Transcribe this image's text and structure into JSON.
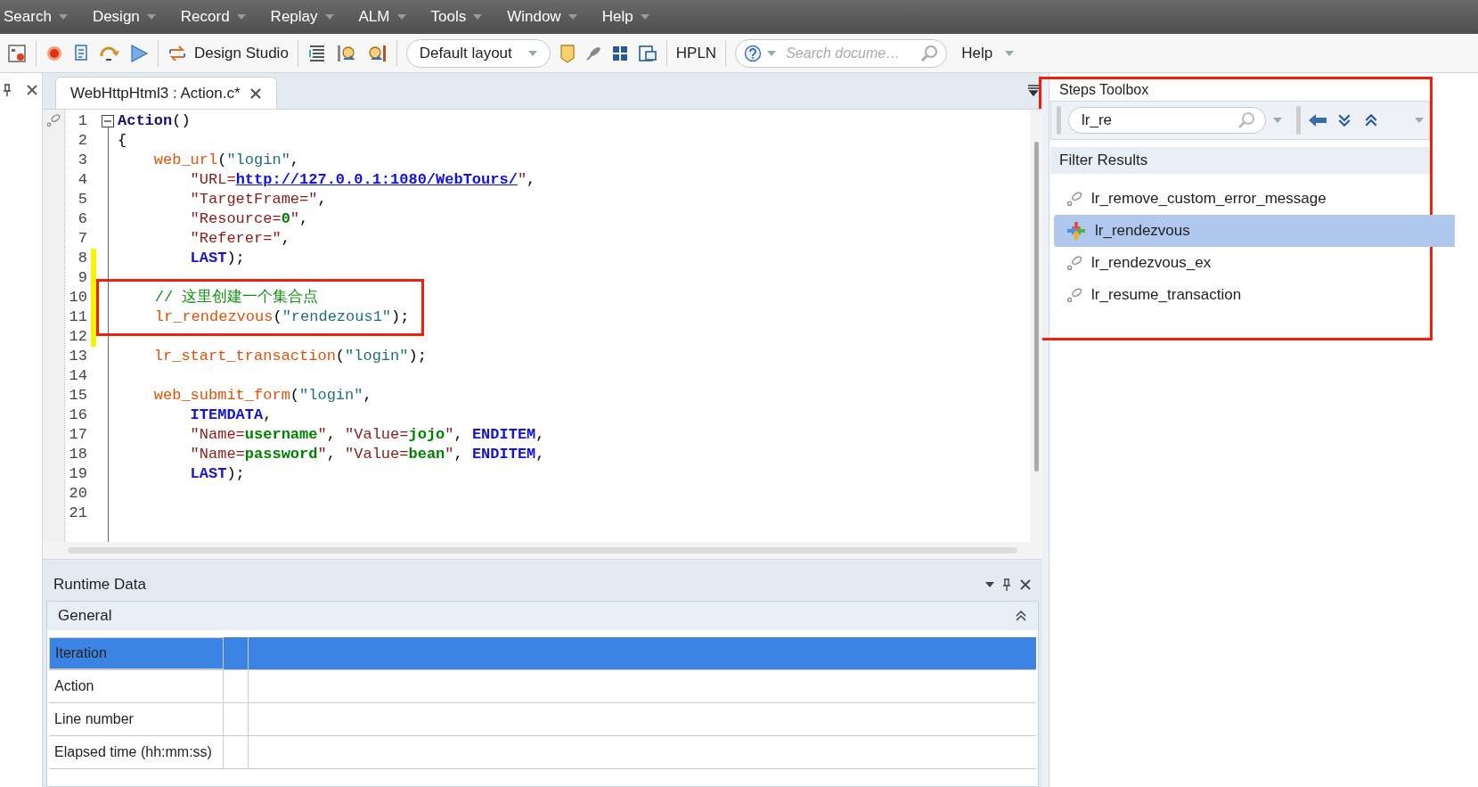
{
  "menu_bar": [
    "Search",
    "Design",
    "Record",
    "Replay",
    "ALM",
    "Tools",
    "Window",
    "Help"
  ],
  "toolbar": {
    "design_studio": "Design Studio",
    "layout": "Default layout",
    "hpln": "HPLN",
    "search_placeholder": "Search docume…",
    "help": "Help"
  },
  "editor": {
    "tab": {
      "label": "WebHttpHtml3 : Action.c*",
      "selected": true
    },
    "lines": [
      {
        "number": "1",
        "changed": false,
        "boxed": false,
        "tokens": [
          {
            "kind": "decl",
            "text": "Action"
          },
          {
            "kind": "punct",
            "text": "()"
          }
        ]
      },
      {
        "number": "2",
        "changed": false,
        "boxed": false,
        "tokens": [
          {
            "kind": "punct",
            "text": "{"
          }
        ]
      },
      {
        "number": "3",
        "changed": false,
        "boxed": false,
        "tokens": [
          {
            "kind": "fn",
            "text": "    web_url"
          },
          {
            "kind": "punct",
            "text": "("
          },
          {
            "kind": "str",
            "text": "\"login\""
          },
          {
            "kind": "punct",
            "text": ","
          }
        ]
      },
      {
        "number": "4",
        "changed": false,
        "boxed": false,
        "tokens": [
          {
            "kind": "attr",
            "text": "        \"URL="
          },
          {
            "kind": "link",
            "text": "http://127.0.0.1:1080/WebTours/"
          },
          {
            "kind": "attr",
            "text": "\""
          },
          {
            "kind": "punct",
            "text": ","
          }
        ]
      },
      {
        "number": "5",
        "changed": false,
        "boxed": false,
        "tokens": [
          {
            "kind": "attr",
            "text": "        \"TargetFrame=\""
          },
          {
            "kind": "punct",
            "text": ","
          }
        ]
      },
      {
        "number": "6",
        "changed": false,
        "boxed": false,
        "tokens": [
          {
            "kind": "attr",
            "text": "        \"Resource="
          },
          {
            "kind": "val",
            "text": "0"
          },
          {
            "kind": "attr",
            "text": "\""
          },
          {
            "kind": "punct",
            "text": ","
          }
        ]
      },
      {
        "number": "7",
        "changed": false,
        "boxed": false,
        "tokens": [
          {
            "kind": "attr",
            "text": "        \"Referer=\""
          },
          {
            "kind": "punct",
            "text": ","
          }
        ]
      },
      {
        "number": "8",
        "changed": true,
        "boxed": false,
        "tokens": [
          {
            "kind": "kw",
            "text": "        LAST"
          },
          {
            "kind": "punct",
            "text": ");"
          }
        ]
      },
      {
        "number": "9",
        "changed": true,
        "boxed": false
      },
      {
        "number": "10",
        "changed": true,
        "boxed": true,
        "tokens": [
          {
            "kind": "comment",
            "text": "    // 这里创建一个集合点"
          }
        ]
      },
      {
        "number": "11",
        "changed": true,
        "boxed": true,
        "tokens": [
          {
            "kind": "fn",
            "text": "    lr_rendezvous"
          },
          {
            "kind": "punct",
            "text": "("
          },
          {
            "kind": "str",
            "text": "\"rendezous1\""
          },
          {
            "kind": "punct",
            "text": ");"
          }
        ]
      },
      {
        "number": "12",
        "changed": true,
        "boxed": false
      },
      {
        "number": "13",
        "changed": false,
        "boxed": false,
        "tokens": [
          {
            "kind": "fn",
            "text": "    lr_start_transaction"
          },
          {
            "kind": "punct",
            "text": "("
          },
          {
            "kind": "str",
            "text": "\"login\""
          },
          {
            "kind": "punct",
            "text": ");"
          }
        ]
      },
      {
        "number": "14",
        "changed": false,
        "boxed": false
      },
      {
        "number": "15",
        "changed": false,
        "boxed": false,
        "tokens": [
          {
            "kind": "fn",
            "text": "    web_submit_form"
          },
          {
            "kind": "punct",
            "text": "("
          },
          {
            "kind": "str",
            "text": "\"login\""
          },
          {
            "kind": "punct",
            "text": ","
          }
        ]
      },
      {
        "number": "16",
        "changed": false,
        "boxed": false,
        "tokens": [
          {
            "kind": "kw",
            "text": "        ITEMDATA"
          },
          {
            "kind": "punct",
            "text": ","
          }
        ]
      },
      {
        "number": "17",
        "changed": false,
        "boxed": false,
        "tokens": [
          {
            "kind": "attr",
            "text": "        \"Name="
          },
          {
            "kind": "val",
            "text": "username"
          },
          {
            "kind": "attr",
            "text": "\""
          },
          {
            "kind": "punct",
            "text": ", "
          },
          {
            "kind": "attr",
            "text": "\"Value="
          },
          {
            "kind": "val",
            "text": "jojo"
          },
          {
            "kind": "attr",
            "text": "\""
          },
          {
            "kind": "punct",
            "text": ", "
          },
          {
            "kind": "kw",
            "text": "ENDITEM"
          },
          {
            "kind": "punct",
            "text": ","
          }
        ]
      },
      {
        "number": "18",
        "changed": false,
        "boxed": false,
        "tokens": [
          {
            "kind": "attr",
            "text": "        \"Name="
          },
          {
            "kind": "val",
            "text": "password"
          },
          {
            "kind": "attr",
            "text": "\""
          },
          {
            "kind": "punct",
            "text": ", "
          },
          {
            "kind": "attr",
            "text": "\"Value="
          },
          {
            "kind": "val",
            "text": "bean"
          },
          {
            "kind": "attr",
            "text": "\""
          },
          {
            "kind": "punct",
            "text": ", "
          },
          {
            "kind": "kw",
            "text": "ENDITEM"
          },
          {
            "kind": "punct",
            "text": ","
          }
        ]
      },
      {
        "number": "19",
        "changed": false,
        "boxed": false,
        "tokens": [
          {
            "kind": "kw",
            "text": "        LAST"
          },
          {
            "kind": "punct",
            "text": ");"
          }
        ]
      },
      {
        "number": "20",
        "changed": false,
        "boxed": false
      },
      {
        "number": "21",
        "changed": false,
        "boxed": false
      }
    ]
  },
  "runtime_data": {
    "title": "Runtime Data",
    "section": "General",
    "rows": [
      {
        "label": "Iteration",
        "selected": true
      },
      {
        "label": "Action",
        "selected": false
      },
      {
        "label": "Line number",
        "selected": false
      },
      {
        "label": "Elapsed time (hh:mm:ss)",
        "selected": false
      }
    ]
  },
  "steps_toolbox": {
    "title": "Steps Toolbox",
    "annotated": true,
    "filter_value": "lr_re",
    "results_title": "Filter Results",
    "results": [
      {
        "label": "lr_remove_custom_error_message",
        "kind": "step",
        "selected": false
      },
      {
        "label": "lr_rendezvous",
        "kind": "rendezvous",
        "selected": true
      },
      {
        "label": "lr_rendezvous_ex",
        "kind": "step",
        "selected": false
      },
      {
        "label": "lr_resume_transaction",
        "kind": "step",
        "selected": false
      }
    ]
  }
}
